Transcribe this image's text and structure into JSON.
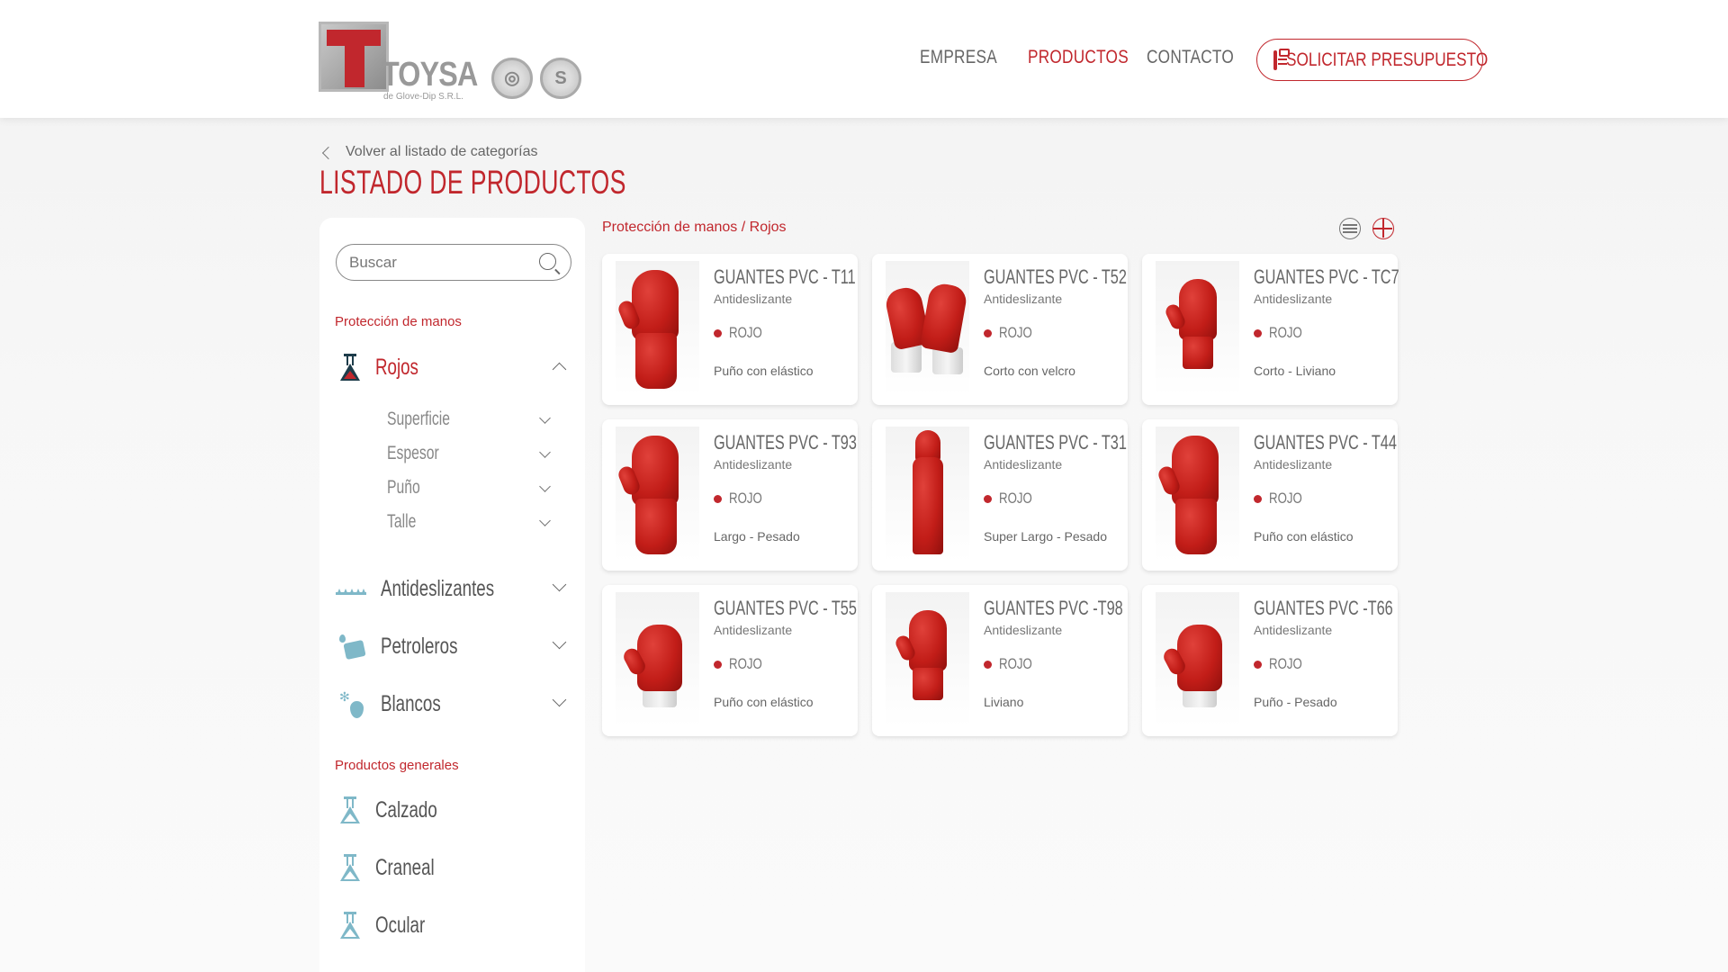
{
  "brand": {
    "name": "TOYSA",
    "subtitle": "de Glove-Dip S.R.L."
  },
  "nav": {
    "items": [
      {
        "label": "EMPRESA",
        "active": false
      },
      {
        "label": "PRODUCTOS",
        "active": true
      },
      {
        "label": "CONTACTO",
        "active": false
      }
    ],
    "cta_label": "SOLICITAR PRESUPUESTO"
  },
  "page": {
    "back_label": "Volver al listado de categorías",
    "title": "LISTADO DE PRODUCTOS",
    "breadcrumb": "Protección de manos / Rojos"
  },
  "sidebar": {
    "search_placeholder": "Buscar",
    "section1": "Protección de manos",
    "active_category": "Rojos",
    "filters": [
      "Superficie",
      "Espesor",
      "Puño",
      "Talle"
    ],
    "categories": [
      "Antideslizantes",
      "Petroleros",
      "Blancos"
    ],
    "section2": "Productos generales",
    "general": [
      "Calzado",
      "Craneal",
      "Ocular"
    ]
  },
  "products": [
    {
      "name": "GUANTES PVC - T11",
      "type": "Antideslizante",
      "color": "ROJO",
      "desc": "Puño con elástico",
      "image": "red-glove-long"
    },
    {
      "name": "GUANTES PVC - T52",
      "type": "Antideslizante",
      "color": "ROJO",
      "desc": "Corto con velcro",
      "image": "red-glove-pair-velcro"
    },
    {
      "name": "GUANTES PVC - TC7",
      "type": "Antideslizante",
      "color": "ROJO",
      "desc": "Corto - Liviano",
      "image": "red-glove-short"
    },
    {
      "name": "GUANTES PVC - T93",
      "type": "Antideslizante",
      "color": "ROJO",
      "desc": "Largo - Pesado",
      "image": "red-glove-long"
    },
    {
      "name": "GUANTES PVC - T31",
      "type": "Antideslizante",
      "color": "ROJO",
      "desc": "Super Largo - Pesado",
      "image": "red-glove-super-long"
    },
    {
      "name": "GUANTES PVC - T44",
      "type": "Antideslizante",
      "color": "ROJO",
      "desc": "Puño con elástico",
      "image": "red-glove-long"
    },
    {
      "name": "GUANTES PVC - T55",
      "type": "Antideslizante",
      "color": "ROJO",
      "desc": "Puño con elástico",
      "image": "red-glove-elastic-cuff"
    },
    {
      "name": "GUANTES PVC -T98",
      "type": "Antideslizante",
      "color": "ROJO",
      "desc": "Liviano",
      "image": "red-glove-short"
    },
    {
      "name": "GUANTES PVC -T66",
      "type": "Antideslizante",
      "color": "ROJO",
      "desc": "Puño - Pesado",
      "image": "red-glove-elastic-cuff"
    }
  ],
  "colors": {
    "accent": "#c1272d",
    "icon": "#7fb8c8",
    "icon_dark": "#1d3c4a"
  }
}
